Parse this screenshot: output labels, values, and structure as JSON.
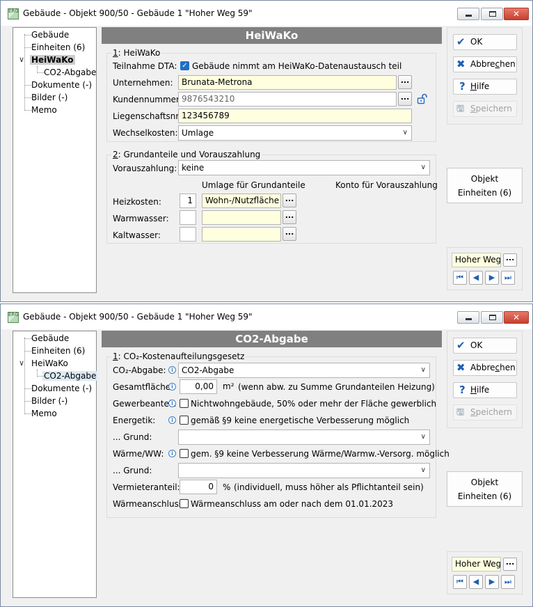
{
  "windows": [
    {
      "title": "Gebäude - Objekt 900/50 - Gebäude 1 \"Hoher Weg 59\"",
      "app_icon_text": "ERG",
      "tree": [
        "Gebäude",
        "Einheiten (6)",
        "HeiWaKo",
        "CO2-Abgabe",
        "Dokumente (-)",
        "Bilder (-)",
        "Memo"
      ],
      "header": "HeiWaKo",
      "group1": {
        "title_num": "1",
        "title": ": HeiWaKo",
        "teilnahme_label": "Teilnahme DTA:",
        "teilnahme_text": "Gebäude nimmt am HeiWaKo-Datenaustausch teil",
        "teilnahme_checked": true,
        "unternehmen_label": "Unternehmen:",
        "unternehmen_value": "Brunata-Metrona",
        "kundennummer_label": "Kundennummer:",
        "kundennummer_value": "9876543210",
        "liegenschaft_label": "Liegenschaftsnr.:",
        "liegenschaft_value": "123456789",
        "wechsel_label": "Wechselkosten:",
        "wechsel_value": "Umlage"
      },
      "group2": {
        "title_num": "2",
        "title": ": Grundanteile und Vorauszahlung",
        "voraus_label": "Vorauszahlung:",
        "voraus_value": "keine",
        "col_umlage": "Umlage für Grundanteile",
        "col_konto": "Konto für Vorauszahlung",
        "heiz_label": "Heizkosten:",
        "heiz_num": "1",
        "heiz_value": "Wohn-/Nutzfläche",
        "warm_label": "Warmwasser:",
        "warm_num": "",
        "warm_value": "",
        "kalt_label": "Kaltwasser:",
        "kalt_num": "",
        "kalt_value": ""
      },
      "buttons": {
        "ok_pre": "OK",
        "ok_acc": "",
        "ok_post": "",
        "cancel_pre": "Abbre",
        "cancel_acc": "c",
        "cancel_post": "hen",
        "help_pre": "",
        "help_acc": "H",
        "help_post": "ilfe",
        "save_pre": "",
        "save_acc": "S",
        "save_post": "peichern"
      },
      "objekt_line1": "Objekt",
      "objekt_line2": "Einheiten (6)",
      "nav_value": "Hoher Weg 59"
    },
    {
      "title": "Gebäude - Objekt 900/50 - Gebäude 1 \"Hoher Weg 59\"",
      "app_icon_text": "ERG",
      "tree": [
        "Gebäude",
        "Einheiten (6)",
        "HeiWaKo",
        "CO2-Abgabe",
        "Dokumente (-)",
        "Bilder (-)",
        "Memo"
      ],
      "header": "CO2-Abgabe",
      "group1": {
        "title_num": "1",
        "title": ": CO₂-Kostenaufteilungsgesetz",
        "co2_label": "CO₂-Abgabe:",
        "co2_value": "CO2-Abgabe",
        "gesamt_label": "Gesamtfläche:",
        "gesamt_value": "0,00",
        "gesamt_unit": "m²",
        "gesamt_note": "(wenn abw. zu Summe Grundanteilen Heizung)",
        "gewerbe_label": "Gewerbeanteil:",
        "gewerbe_text": "Nichtwohngebäude, 50% oder mehr der Fläche gewerblich",
        "energetik_label": "Energetik:",
        "energetik_text": "gemäß §9 keine energetische Verbesserung möglich",
        "grund1_label": "... Grund:",
        "grund1_value": "",
        "waerme_label": "Wärme/WW:",
        "waerme_text": "gem. §9 keine Verbesserung Wärme/Warmw.-Versorg. möglich",
        "grund2_label": "... Grund:",
        "grund2_value": "",
        "vermieter_label": "Vermieteranteil:",
        "vermieter_value": "0",
        "vermieter_unit": "%",
        "vermieter_note": "(individuell, muss höher als Pflichtanteil sein)",
        "anschluss_label": "Wärmeanschluss:",
        "anschluss_text": "Wärmeanschluss am oder nach dem 01.01.2023"
      },
      "buttons": {
        "ok_pre": "OK",
        "ok_acc": "",
        "ok_post": "",
        "cancel_pre": "Abbre",
        "cancel_acc": "c",
        "cancel_post": "hen",
        "help_pre": "",
        "help_acc": "H",
        "help_post": "ilfe",
        "save_pre": "",
        "save_acc": "S",
        "save_post": "peichern"
      },
      "objekt_line1": "Objekt",
      "objekt_line2": "Einheiten (6)",
      "nav_value": "Hoher Weg 59"
    }
  ]
}
